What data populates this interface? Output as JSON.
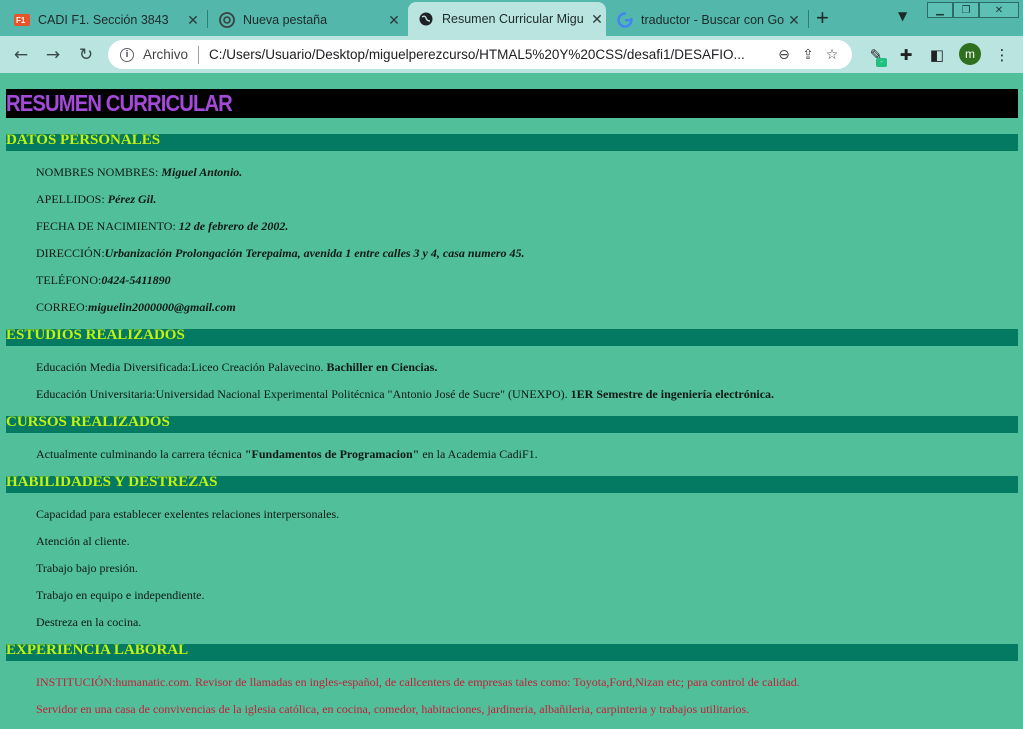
{
  "browser": {
    "tabs": [
      {
        "title": "CADI F1. Sección 3843",
        "icon": "cadi-f1-favicon"
      },
      {
        "title": "Nueva pestaña",
        "icon": "chrome-favicon"
      },
      {
        "title": "Resumen Curricular Migu",
        "icon": "globe-favicon",
        "active": true
      },
      {
        "title": "traductor - Buscar con Go",
        "icon": "google-favicon"
      }
    ],
    "new_tab": "+",
    "address_scheme": "Archivo",
    "address_url": "C:/Users/Usuario/Desktop/miguelperezcurso/HTMAL5%20Y%20CSS/desafi1/DESAFIO...",
    "profile_initial": "m"
  },
  "resume": {
    "title": "RESUMEN CURRICULAR",
    "sections": {
      "personal": "DATOS PERSONALES",
      "studies": "ESTUDIOS REALIZADOS",
      "courses": "CURSOS REALIZADOS",
      "skills": "HABILIDADES Y DESTREZAS",
      "experience": "EXPERIENCIA LABORAL"
    },
    "personal": {
      "names_label": "NOMBRES NOMBRES: ",
      "names_value": "Miguel Antonio.",
      "surnames_label": "APELLIDOS: ",
      "surnames_value": "Pérez Gil.",
      "birth_label": "FECHA DE NACIMIENTO: ",
      "birth_value": "12 de febrero de 2002.",
      "address_label": "DIRECCIÓN:",
      "address_value": "Urbanización Prolongación Terepaima, avenida 1 entre calles 3 y 4, casa numero 45.",
      "phone_label": "TELÉFONO:",
      "phone_value": "0424-5411890",
      "email_label": "CORREO:",
      "email_value": "miguelin2000000@gmail.com"
    },
    "studies": {
      "media_text": "Educación Media Diversificada:Liceo Creación Palavecino. ",
      "media_bold": "Bachiller en Ciencias.",
      "univ_text": "Educación Universitaria:Universidad Nacional Experimental Politécnica \"Antonio José de Sucre\" (UNEXPO). ",
      "univ_bold": "1ER Semestre de ingeniería electrónica."
    },
    "courses": {
      "pre": "Actualmente culminando la carrera técnica ",
      "bold": "\"Fundamentos de Programacion\"",
      "post": " en la Academia CadiF1."
    },
    "skills": [
      "Capacidad para establecer exelentes relaciones interpersonales.",
      "Atención al cliente.",
      "Trabajo bajo presión.",
      "Trabajo en equipo e independiente.",
      "Destreza en la cocina."
    ],
    "experience": [
      "INSTITUCIÓN:humanatic.com. Revisor de llamadas en ingles-español, de callcenters de empresas tales como: Toyota,Ford,Nizan etc; para control de calidad.",
      "Servidor en una casa de convivencias de la iglesia católica, en cocina, comedor, habitaciones, jardineria, albañileria, carpinteria y trabajos utilitarios."
    ]
  },
  "colors": {
    "page_bg": "#52bf9b",
    "section_bg": "#047a63",
    "section_text": "#c2f20f",
    "title_text": "#a34ad8",
    "experience_text": "#c2203a"
  }
}
